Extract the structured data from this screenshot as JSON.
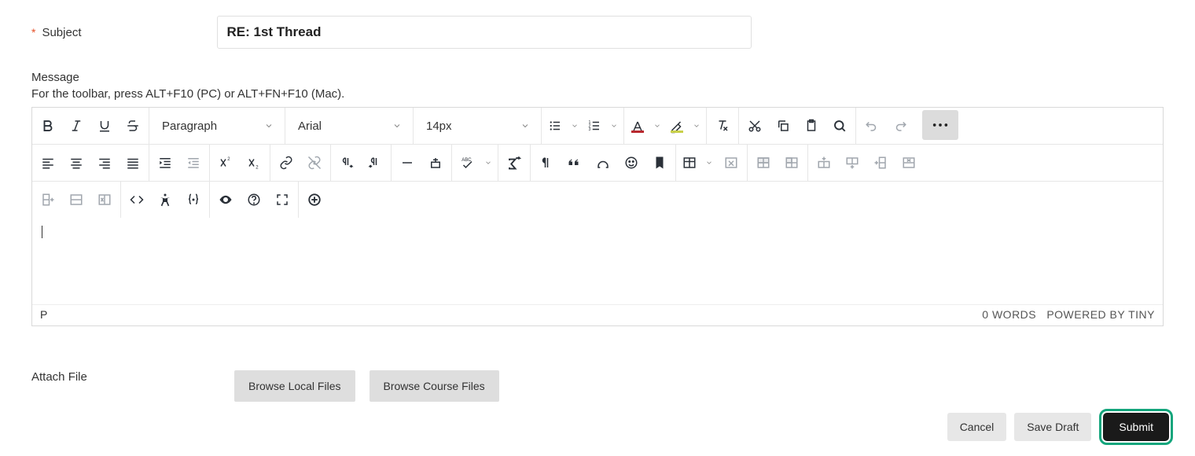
{
  "subject": {
    "label": "Subject",
    "value": "RE: 1st Thread"
  },
  "message": {
    "label": "Message",
    "help": "For the toolbar, press ALT+F10 (PC) or ALT+FN+F10 (Mac)."
  },
  "toolbar": {
    "paragraph": "Paragraph",
    "font": "Arial",
    "size": "14px",
    "spellcheck_label": "ABC",
    "text_color": "#b8292f",
    "highlight_color": "#c9d04a"
  },
  "status": {
    "path": "P",
    "words": "0 WORDS",
    "powered": "POWERED BY TINY"
  },
  "attach": {
    "label": "Attach File",
    "browse_local": "Browse Local Files",
    "browse_course": "Browse Course Files"
  },
  "actions": {
    "cancel": "Cancel",
    "save_draft": "Save Draft",
    "submit": "Submit"
  }
}
